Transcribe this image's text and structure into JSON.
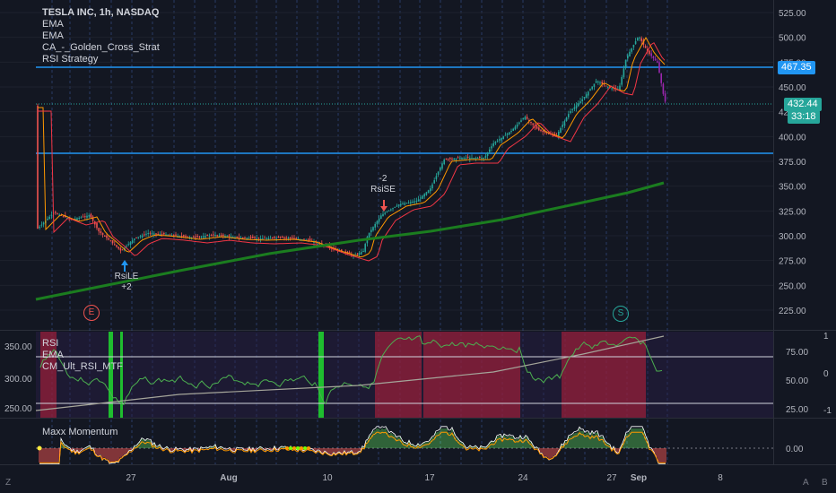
{
  "header": {
    "title": "TESLA INC, 1h, NASDAQ",
    "indicators": [
      "EMA",
      "EMA",
      "CA_-_Golden_Cross_Strat",
      "RSI Strategy"
    ]
  },
  "price_axis": {
    "ticks": [
      "525.00",
      "500.00",
      "475.00",
      "450.00",
      "425.00",
      "400.00",
      "375.00",
      "350.00",
      "325.00",
      "300.00",
      "275.00",
      "250.00",
      "225.00"
    ],
    "tag_level": "467.35",
    "tag_last": "432.44",
    "tag_countdown": "33:18",
    "colors": {
      "level": "#2196f3",
      "last": "#26a69a",
      "countdown": "#26a69a"
    }
  },
  "markers": {
    "rsi_le": {
      "label": "RsiLE",
      "qty": "+2"
    },
    "rsi_se": {
      "label": "RsiSE",
      "qty": "-2"
    },
    "earnings": "E",
    "split": "S"
  },
  "rsi_pane": {
    "labels": [
      "RSI",
      "EMA",
      "CM_Ult_RSI_MTF"
    ],
    "left_ticks": [
      "350.00",
      "300.00",
      "250.00"
    ],
    "right_ticks": [
      "75.00",
      "50.00",
      "25.00"
    ],
    "far_right_ticks": [
      "1",
      "0",
      "-1"
    ]
  },
  "momentum_pane": {
    "label": "Maxx Momentum",
    "tick": "0.00"
  },
  "time_axis": {
    "labels": [
      "27",
      "Aug",
      "10",
      "17",
      "24",
      "27",
      "Sep",
      "8"
    ]
  },
  "corner": {
    "left": "Z",
    "right_a": "A",
    "right_b": "B"
  }
}
